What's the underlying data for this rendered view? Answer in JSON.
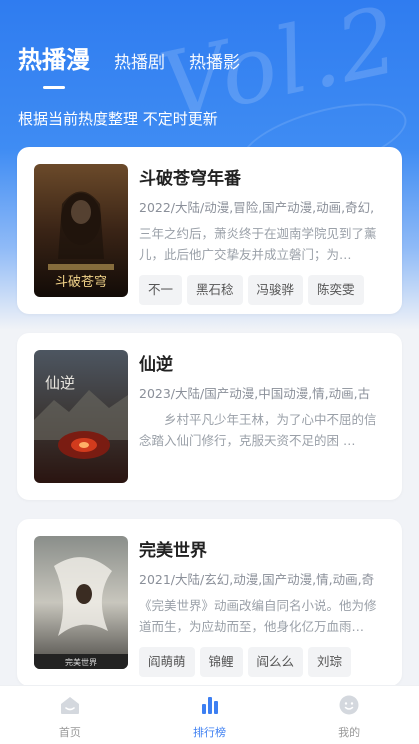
{
  "header": {
    "tabs": [
      {
        "label": "热播漫",
        "active": true
      },
      {
        "label": "热播剧",
        "active": false
      },
      {
        "label": "热播影",
        "active": false
      }
    ],
    "subtitle": "根据当前热度整理 不定时更新"
  },
  "list": [
    {
      "title": "斗破苍穹年番",
      "meta": "2022/大陆/动漫,冒险,国产动漫,动画,奇幻,",
      "desc": "三年之约后，萧炎终于在迦南学院见到了薰儿，此后他广交挚友并成立磐门；为…",
      "cast": [
        "不一",
        "黑石稔",
        "冯骏骅",
        "陈奕雯"
      ],
      "cover_text": "斗破苍穹"
    },
    {
      "title": "仙逆",
      "meta": "2023/大陆/国产动漫,中国动漫,情,动画,古",
      "desc": "　　乡村平凡少年王林，为了心中不屈的信念踏入仙门修行，克服天资不足的困 …",
      "cast": [],
      "cover_text": "仙逆"
    },
    {
      "title": "完美世界",
      "meta": "2021/大陆/玄幻,动漫,国产动漫,情,动画,奇",
      "desc": "《完美世界》动画改编自同名小说。他为修道而生，为应劫而至，他身化亿万血雨…",
      "cast": [
        "阎萌萌",
        "锦鲤",
        "阎么么",
        "刘琮"
      ],
      "cover_text": "完美世界"
    }
  ],
  "bottom_nav": [
    {
      "label": "首页",
      "icon": "home-icon",
      "active": false
    },
    {
      "label": "排行榜",
      "icon": "ranking-icon",
      "active": true
    },
    {
      "label": "我的",
      "icon": "profile-icon",
      "active": false
    }
  ],
  "colors": {
    "accent": "#3d7ff2",
    "hero": "#2f7cf0"
  }
}
